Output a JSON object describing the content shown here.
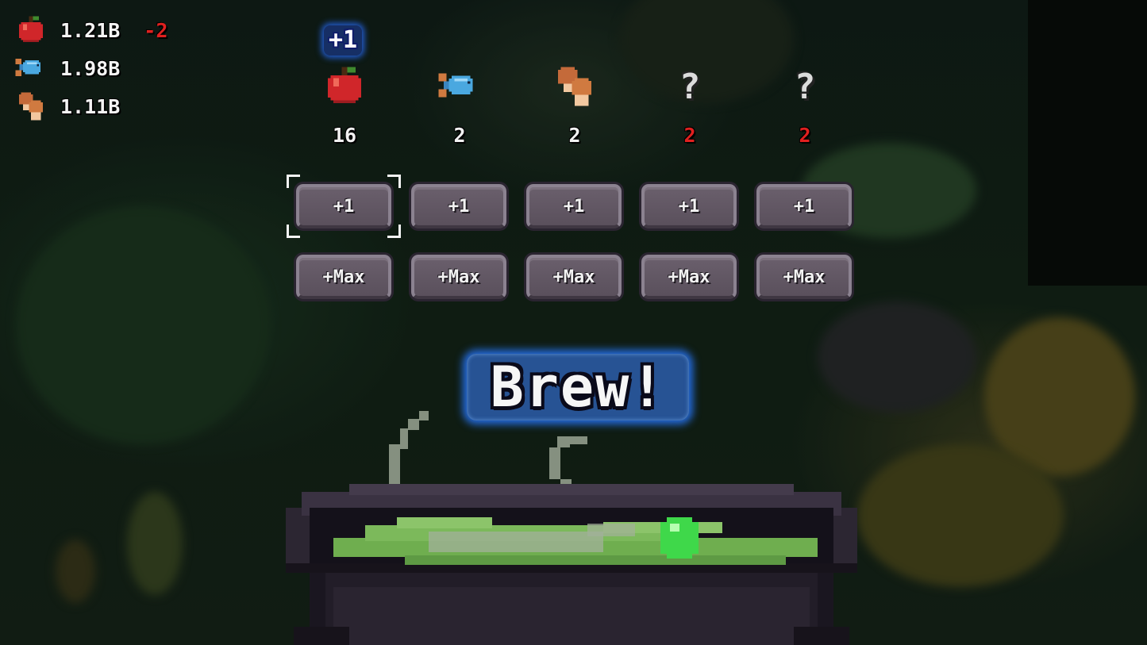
{
  "resources": [
    {
      "icon": "apple-icon",
      "value": "1.21B",
      "delta": "-2"
    },
    {
      "icon": "fish-icon",
      "value": "1.98B",
      "delta": ""
    },
    {
      "icon": "mushroom-icon",
      "value": "1.11B",
      "delta": ""
    }
  ],
  "float_text": "+1",
  "ingredients": [
    {
      "icon": "apple-icon",
      "count": "16",
      "count_color": "#f2f2f2"
    },
    {
      "icon": "fish-icon",
      "count": "2",
      "count_color": "#f2f2f2"
    },
    {
      "icon": "mushroom-icon",
      "count": "2",
      "count_color": "#f2f2f2"
    },
    {
      "icon": "question-mark-icon",
      "symbol": "?",
      "count": "2",
      "count_color": "#e0201f"
    },
    {
      "icon": "question-mark-icon",
      "symbol": "?",
      "count": "2",
      "count_color": "#e0201f"
    }
  ],
  "buttons": {
    "plus_one": [
      "+1",
      "+1",
      "+1",
      "+1",
      "+1"
    ],
    "plus_max": [
      "+Max",
      "+Max",
      "+Max",
      "+Max",
      "+Max"
    ]
  },
  "brew_label": "Brew!",
  "colors": {
    "accent_glow": "#3c82ff",
    "warning_red": "#e0201f",
    "potion_green": "#6fae4f"
  }
}
